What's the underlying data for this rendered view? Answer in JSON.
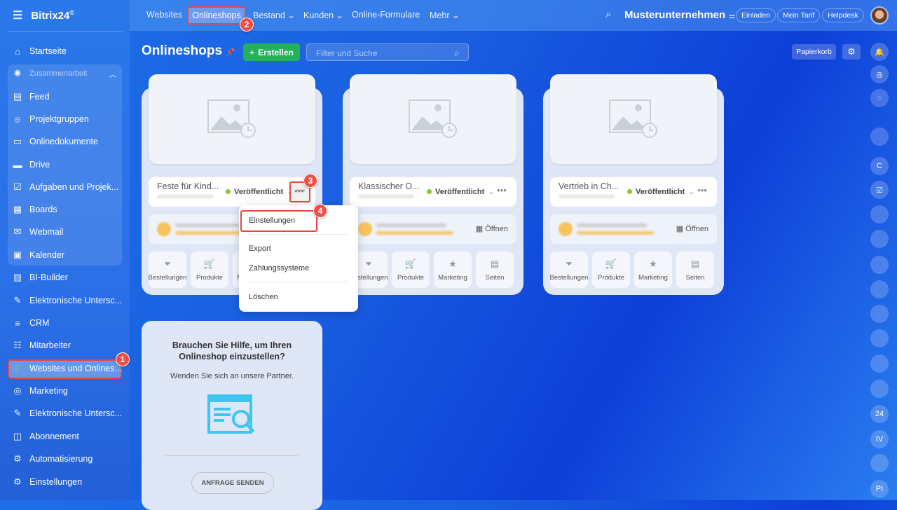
{
  "app": {
    "logo": "Bitrix24",
    "logo_mark": "©"
  },
  "sidebar": {
    "items": [
      {
        "label": "Startseite",
        "icon": "home-icon"
      },
      {
        "label": "Zusammenarbeit",
        "icon": "collab-icon"
      },
      {
        "label": "Feed",
        "icon": "feed-icon"
      },
      {
        "label": "Projektgruppen",
        "icon": "group-icon"
      },
      {
        "label": "Onlinedokumente",
        "icon": "doc-icon"
      },
      {
        "label": "Drive",
        "icon": "drive-icon"
      },
      {
        "label": "Aufgaben und Projek...",
        "icon": "task-icon"
      },
      {
        "label": "Boards",
        "icon": "board-icon"
      },
      {
        "label": "Webmail",
        "icon": "mail-icon"
      },
      {
        "label": "Kalender",
        "icon": "calendar-icon"
      },
      {
        "label": "BI-Builder",
        "icon": "chart-icon"
      },
      {
        "label": "Elektronische Untersc...",
        "icon": "sign-icon"
      },
      {
        "label": "CRM",
        "icon": "crm-icon"
      },
      {
        "label": "Mitarbeiter",
        "icon": "staff-icon"
      },
      {
        "label": "Websites und Onlines...",
        "icon": "cart-icon"
      },
      {
        "label": "Marketing",
        "icon": "target-icon"
      },
      {
        "label": "Elektronische Untersc...",
        "icon": "sign-icon"
      },
      {
        "label": "Abonnement",
        "icon": "sub-icon"
      },
      {
        "label": "Automatisierung",
        "icon": "robot-icon"
      },
      {
        "label": "Einstellungen",
        "icon": "gear-icon"
      }
    ]
  },
  "topbar": {
    "tabs": [
      "Websites",
      "Onlineshops",
      "Bestand",
      "Kunden",
      "Online-Formulare",
      "Mehr"
    ],
    "company": "Musterunternehmen",
    "buttons": [
      "Einladen",
      "Mein Tarif",
      "Helpdesk"
    ]
  },
  "page": {
    "title": "Onlineshops",
    "create": "Erstellen",
    "search_placeholder": "Filter und Suche",
    "trash": "Papierkorb"
  },
  "shops": [
    {
      "name": "Feste für Kind...",
      "status": "Veröffentlicht"
    },
    {
      "name": "Klassischer O...",
      "status": "Veröffentlicht",
      "open": "Öffnen"
    },
    {
      "name": "Vertrieb in Ch...",
      "status": "Veröffentlicht",
      "open": "Öffnen"
    }
  ],
  "actions": [
    "Bestellungen",
    "Produkte",
    "Marketing",
    "Seiten"
  ],
  "menu": {
    "items": [
      "Einstellungen",
      "Export",
      "Zahlungssysteme",
      "Löschen"
    ]
  },
  "help": {
    "title": "Brauchen Sie Hilfe, um Ihren Onlineshop einzustellen?",
    "text": "Wenden Sie sich an unsere Partner.",
    "button": "ANFRAGE SENDEN"
  },
  "steps": [
    "1",
    "2",
    "3",
    "4"
  ],
  "right_bar": {
    "label_24": "24",
    "iv": "IV",
    "pi": "PI",
    "c": "C"
  },
  "colors": {
    "accent": "#23b15a",
    "highlight": "#e5483f",
    "status": "#8cc82a"
  }
}
